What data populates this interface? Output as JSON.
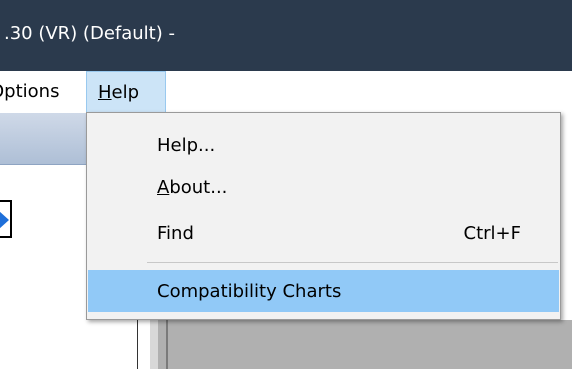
{
  "window": {
    "title": ".30 (VR) (Default) -"
  },
  "menubar": {
    "options_label": "Options",
    "help_label_underlined": "H",
    "help_label_rest": "elp"
  },
  "help_menu": {
    "items": [
      {
        "label": "Help...",
        "shortcut": ""
      },
      {
        "label_underlined": "A",
        "label_rest": "bout...",
        "shortcut": ""
      },
      {
        "label": "Find",
        "shortcut": "Ctrl+F"
      },
      {
        "label": "Compatibility Charts",
        "shortcut": ""
      }
    ],
    "selected_index": 3
  },
  "colors": {
    "titlebar": "#2b3a4d",
    "menu_highlight": "#91c9f7",
    "menubar_active": "#cce4f7"
  }
}
